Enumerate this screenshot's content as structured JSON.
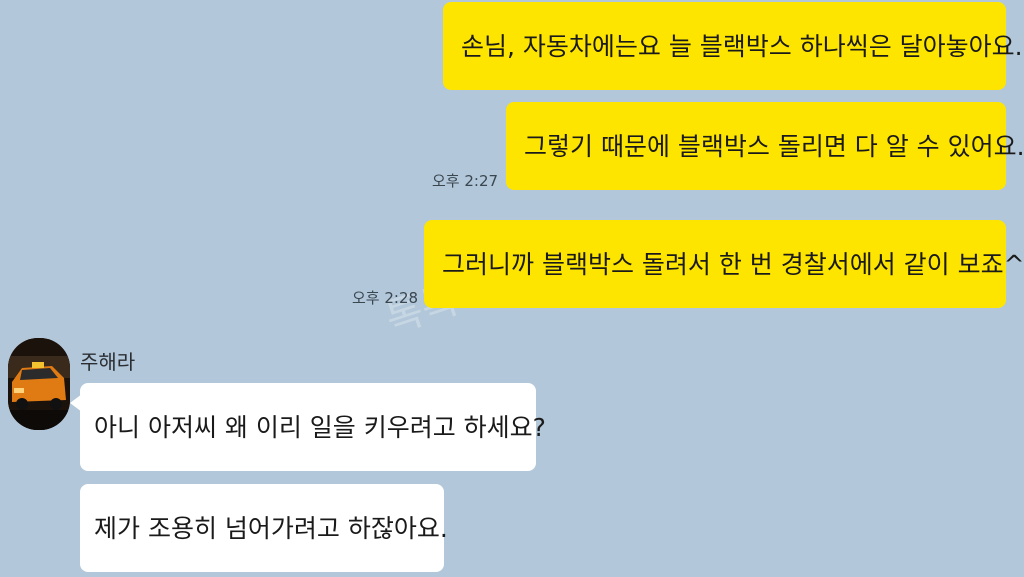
{
  "messages": [
    {
      "text": "손님, 자동차에는요 늘 블랙박스 하나씩은 달아놓아요."
    },
    {
      "text": "그렇기 때문에 블랙박스 돌리면 다 알 수 있어요.",
      "time": "오후 2:27"
    },
    {
      "text": "그러니까 블랙박스 돌려서 한 번 경찰서에서 같이 보죠^^",
      "time": "오후 2:28"
    },
    {
      "text": "아니 아저씨 왜 이리 일을 키우려고 하세요?"
    },
    {
      "text": "제가 조용히 넘어가려고 하잖아요."
    }
  ],
  "sender": {
    "name": "주해라"
  },
  "watermark": "톡톡 튀는 사연",
  "colors": {
    "background": "#b2c7d9",
    "my_bubble": "#fee500",
    "other_bubble": "#ffffff"
  }
}
